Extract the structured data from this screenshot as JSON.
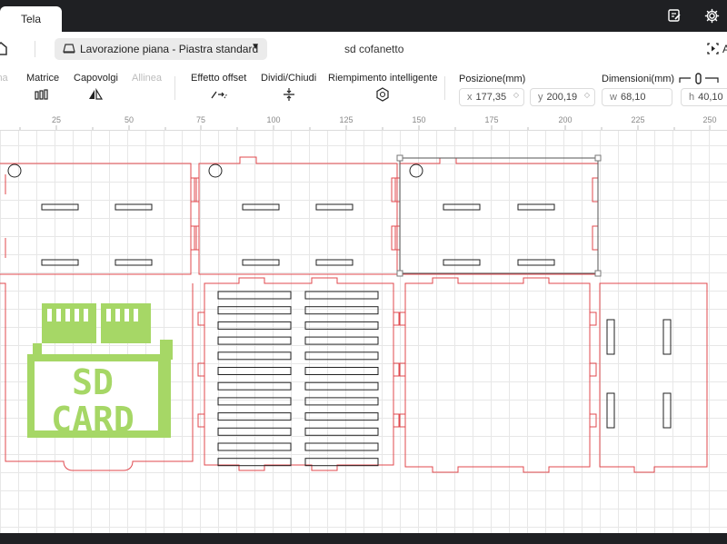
{
  "window": {
    "tab_label": "Tela",
    "notes_icon": "edit-note-icon",
    "settings_icon": "gear-icon"
  },
  "header": {
    "mode_select": "Lavorazione piana - Piastra standard",
    "project_title": "sd cofanetto",
    "right_button": "A"
  },
  "toolbar": {
    "tools": [
      {
        "name": "align-partial",
        "label": "ina",
        "icon": "align-icon",
        "enabled": false
      },
      {
        "name": "matrice",
        "label": "Matrice",
        "icon": "array-icon",
        "enabled": true
      },
      {
        "name": "capovolgi",
        "label": "Capovolgi",
        "icon": "flip-icon",
        "enabled": true
      },
      {
        "name": "allinea",
        "label": "Allinea",
        "icon": "align-icon",
        "enabled": false
      },
      {
        "name": "effetto-offset",
        "label": "Effetto offset",
        "icon": "offset-icon",
        "enabled": true
      },
      {
        "name": "dividi-chiudi",
        "label": "Dividi/Chiudi",
        "icon": "split-icon",
        "enabled": true
      },
      {
        "name": "riempimento",
        "label": "Riempimento intelligente",
        "icon": "smart-fill-icon",
        "enabled": true
      }
    ],
    "position_label": "Posizione(mm)",
    "x_prefix": "x",
    "x_value": "177,35",
    "y_prefix": "y",
    "y_value": "200,19",
    "dimensions_label": "Dimensioni(mm)",
    "w_prefix": "w",
    "w_value": "68,10",
    "h_prefix": "h",
    "h_value": "40,10"
  },
  "ruler": {
    "marks": [
      "25",
      "50",
      "75",
      "100",
      "125",
      "150",
      "175",
      "200",
      "225",
      "250"
    ]
  },
  "canvas": {
    "logo_text": [
      "SD",
      "CARD"
    ],
    "colors": {
      "cut_line": "#e0484e",
      "engrave_line": "#222222",
      "logo_fill": "#a6d766",
      "grid": "#e7e7e7"
    }
  }
}
